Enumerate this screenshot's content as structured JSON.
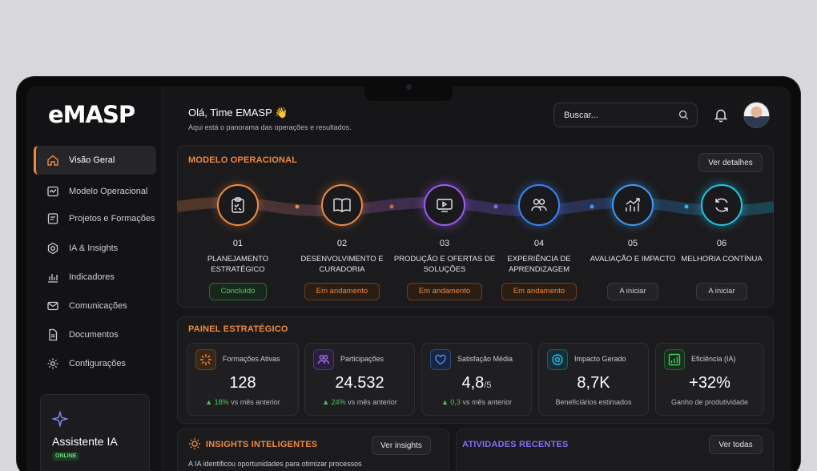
{
  "logo": "eMASP",
  "sidebar": {
    "items": [
      {
        "label": "Visão Geral",
        "icon": "home-icon",
        "active": true
      },
      {
        "label": "Modelo Operacional",
        "icon": "model-icon"
      },
      {
        "label": "Projetos e Formações",
        "icon": "projects-icon"
      },
      {
        "label": "IA & Insights",
        "icon": "ai-icon"
      },
      {
        "label": "Indicadores",
        "icon": "chart-icon"
      },
      {
        "label": "Comunicações",
        "icon": "mail-icon"
      },
      {
        "label": "Documentos",
        "icon": "document-icon"
      },
      {
        "label": "Configurações",
        "icon": "gear-icon"
      }
    ],
    "assistant": {
      "title": "Assistente IA",
      "status": "ONLINE"
    }
  },
  "header": {
    "greeting": "Olá, Time EMASP 👋",
    "subtitle": "Aqui está o panorama das operações e resultados.",
    "search_placeholder": "Buscar..."
  },
  "operational": {
    "title": "MODELO OPERACIONAL",
    "details_button": "Ver detalhes",
    "steps": [
      {
        "num": "01",
        "name": "Planejamento Estratégico",
        "status": "Concluído",
        "color": "#f08a3c"
      },
      {
        "num": "02",
        "name": "Desenvolvimento e Curadoria",
        "status": "Em andamento",
        "color": "#f08a3c"
      },
      {
        "num": "03",
        "name": "Produção e Ofertas de Soluções",
        "status": "Em andamento",
        "color": "#9b5cf6"
      },
      {
        "num": "04",
        "name": "Experiência de Aprendizagem",
        "status": "Em andamento",
        "color": "#3b82f6"
      },
      {
        "num": "05",
        "name": "Avaliação e Impacto",
        "status": "A iniciar",
        "color": "#3b9cf6"
      },
      {
        "num": "06",
        "name": "Melhoria Contínua",
        "status": "A iniciar",
        "color": "#22c3e6"
      }
    ]
  },
  "strategic": {
    "title": "PAINEL ESTRATÉGICO",
    "kpis": [
      {
        "label": "Formações Ativas",
        "value": "128",
        "unit": "",
        "delta": "18%",
        "note": "vs mês anterior",
        "color": "#f08a3c"
      },
      {
        "label": "Participações",
        "value": "24.532",
        "unit": "",
        "delta": "24%",
        "note": "vs mês anterior",
        "color": "#9b5cf6"
      },
      {
        "label": "Satisfação Média",
        "value": "4,8",
        "unit": "/5",
        "delta": "0,3",
        "note": "vs mês anterior",
        "color": "#3b82f6"
      },
      {
        "label": "Impacto Gerado",
        "value": "8,7K",
        "unit": "",
        "delta": "",
        "note": "Beneficiários estimados",
        "color": "#22c3e6"
      },
      {
        "label": "Eficiência (IA)",
        "value": "+32%",
        "unit": "",
        "delta": "",
        "note": "Ganho de produtividade",
        "color": "#48c95d"
      }
    ]
  },
  "insights": {
    "title": "INSIGHTS INTELIGENTES",
    "button": "Ver insights",
    "text": "A IA identificou oportunidades para otimizar processos"
  },
  "activities": {
    "title": "ATIVIDADES RECENTES",
    "button": "Ver todas"
  }
}
